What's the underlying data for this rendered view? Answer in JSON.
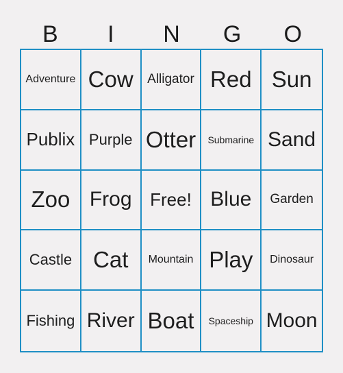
{
  "header": {
    "letters": [
      "B",
      "I",
      "N",
      "G",
      "O"
    ]
  },
  "board": {
    "border_color": "#1f8fc5",
    "background_color": "#f2f0f1",
    "rows": [
      [
        "Adventure",
        "Cow",
        "Alligator",
        "Red",
        "Sun"
      ],
      [
        "Publix",
        "Purple",
        "Otter",
        "Submarine",
        "Sand"
      ],
      [
        "Zoo",
        "Frog",
        "Free!",
        "Blue",
        "Garden"
      ],
      [
        "Castle",
        "Cat",
        "Mountain",
        "Play",
        "Dinosaur"
      ],
      [
        "Fishing",
        "River",
        "Boat",
        "Spaceship",
        "Moon"
      ]
    ]
  }
}
